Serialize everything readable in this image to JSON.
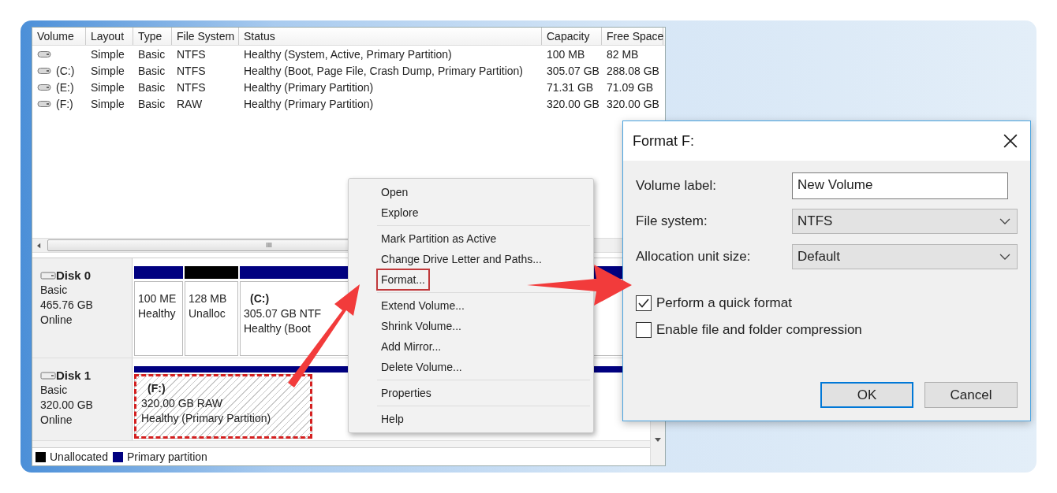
{
  "volume_list": {
    "columns": [
      "Volume",
      "Layout",
      "Type",
      "File System",
      "Status",
      "Capacity",
      "Free Space"
    ],
    "rows": [
      [
        "",
        "Simple",
        "Basic",
        "NTFS",
        "Healthy (System, Active, Primary Partition)",
        "100 MB",
        "82 MB"
      ],
      [
        "(C:)",
        "Simple",
        "Basic",
        "NTFS",
        "Healthy (Boot, Page File, Crash Dump, Primary Partition)",
        "305.07 GB",
        "288.08 GB"
      ],
      [
        "(E:)",
        "Simple",
        "Basic",
        "NTFS",
        "Healthy (Primary Partition)",
        "71.31 GB",
        "71.09 GB"
      ],
      [
        "(F:)",
        "Simple",
        "Basic",
        "RAW",
        "Healthy (Primary Partition)",
        "320.00 GB",
        "320.00 GB"
      ]
    ],
    "scrollbar_grip": "III"
  },
  "disks": [
    {
      "name": "Disk 0",
      "type": "Basic",
      "size": "465.76 GB",
      "status": "Online",
      "partitions": [
        {
          "kind": "primary",
          "lines": [
            "100 ME",
            "Healthy"
          ],
          "highlighted": false
        },
        {
          "kind": "unallocated",
          "lines": [
            "128 MB",
            "Unalloc"
          ],
          "highlighted": false
        },
        {
          "kind": "primary",
          "title": "(C:)",
          "lines": [
            "305.07 GB NTF",
            "Healthy (Boot"
          ],
          "highlighted": false
        }
      ]
    },
    {
      "name": "Disk 1",
      "type": "Basic",
      "size": "320.00 GB",
      "status": "Online",
      "partitions": [
        {
          "kind": "raw",
          "title": "(F:)",
          "lines": [
            "320.00 GB RAW",
            "Healthy (Primary Partition)"
          ],
          "highlighted": true
        }
      ]
    }
  ],
  "legend": [
    {
      "label": "Unallocated",
      "color": "#000000"
    },
    {
      "label": "Primary partition",
      "color": "#000080"
    }
  ],
  "context_menu": {
    "groups": [
      [
        {
          "label": "Open",
          "selected": false
        },
        {
          "label": "Explore",
          "selected": false
        }
      ],
      [
        {
          "label": "Mark Partition as Active",
          "selected": false
        },
        {
          "label": "Change Drive Letter and Paths...",
          "selected": false
        },
        {
          "label": "Format...",
          "selected": true
        }
      ],
      [
        {
          "label": "Extend Volume...",
          "selected": false
        },
        {
          "label": "Shrink Volume...",
          "selected": false
        },
        {
          "label": "Add Mirror...",
          "selected": false
        },
        {
          "label": "Delete Volume...",
          "selected": false
        }
      ],
      [
        {
          "label": "Properties",
          "selected": false
        }
      ],
      [
        {
          "label": "Help",
          "selected": false
        }
      ]
    ]
  },
  "dialog": {
    "title": "Format F:",
    "fields": [
      {
        "kind": "text",
        "label": "Volume label:",
        "value": "New Volume"
      },
      {
        "kind": "dropdown",
        "label": "File system:",
        "value": "NTFS"
      },
      {
        "kind": "dropdown",
        "label": "Allocation unit size:",
        "value": "Default"
      }
    ],
    "options": [
      {
        "label": "Perform a quick format",
        "checked": true
      },
      {
        "label": "Enable file and folder compression",
        "checked": false
      }
    ],
    "buttons": [
      {
        "label": "OK",
        "default": true
      },
      {
        "label": "Cancel",
        "default": false
      }
    ]
  }
}
